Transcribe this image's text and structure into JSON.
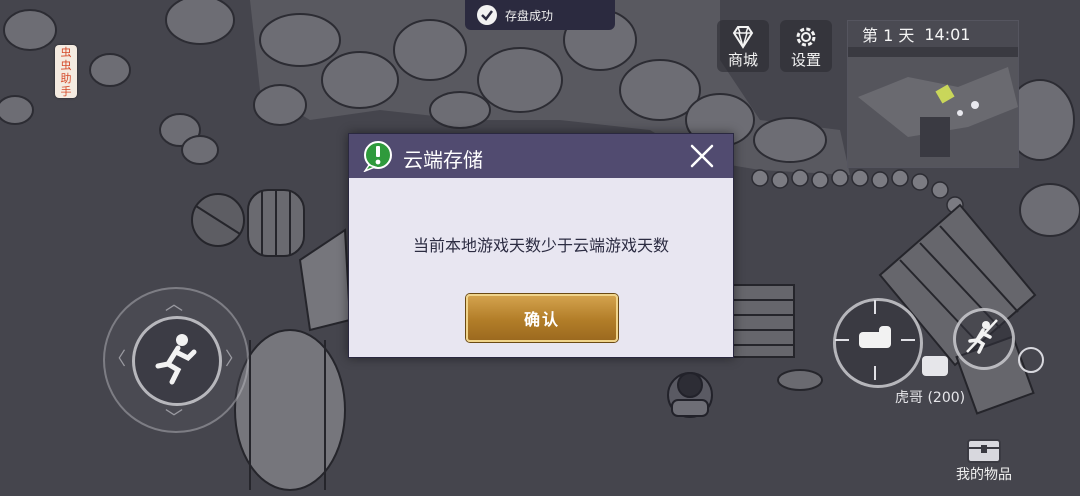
{
  "toast": {
    "text": "存盘成功",
    "icon": "check-circle-icon"
  },
  "helper": {
    "text": "虫虫助手"
  },
  "top_buttons": {
    "shop": {
      "label": "商城",
      "icon": "diamond-icon"
    },
    "settings": {
      "label": "设置",
      "icon": "gear-icon"
    }
  },
  "minimap": {
    "day": "第 1 天",
    "time": "14:01"
  },
  "player": {
    "tag": "虎哥 (200)"
  },
  "inventory": {
    "label": "我的物品",
    "icon": "chest-icon"
  },
  "dialog": {
    "title": "云端存储",
    "message": "当前本地游戏天数少于云端游戏天数",
    "confirm_label": "确认",
    "accent": "#514b70",
    "button_color": "#b27d28"
  }
}
